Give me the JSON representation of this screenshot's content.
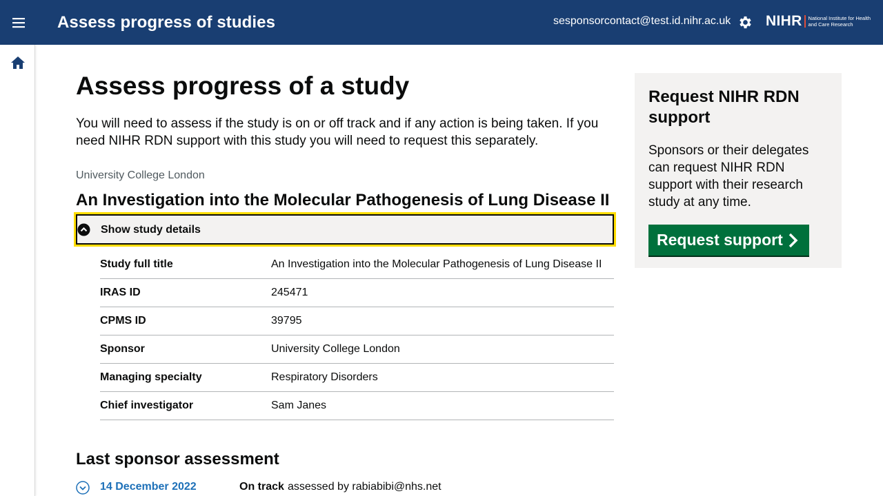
{
  "header": {
    "app_title": "Assess progress of studies",
    "user_email": "sesponsorcontact@test.id.nihr.ac.uk",
    "logo_main": "NIHR",
    "logo_sub": "National Institute for Health and Care Research",
    "brand_color": "#193e72"
  },
  "page": {
    "title": "Assess progress of a study",
    "lead": "You will need to assess if the study is on or off track and if any action is being taken. If you need NIHR RDN support with this study you will need to request this separately.",
    "organisation": "University College London",
    "study_title": "An Investigation into the Molecular Pathogenesis of Lung Disease II",
    "details_toggle_label": "Show study details"
  },
  "study_details": [
    {
      "key": "Study full title",
      "value": "An Investigation into the Molecular Pathogenesis of Lung Disease II"
    },
    {
      "key": "IRAS ID",
      "value": "245471"
    },
    {
      "key": "CPMS ID",
      "value": "39795"
    },
    {
      "key": "Sponsor",
      "value": "University College London"
    },
    {
      "key": "Managing specialty",
      "value": "Respiratory Disorders"
    },
    {
      "key": "Chief investigator",
      "value": "Sam Janes"
    }
  ],
  "last_assessment": {
    "heading": "Last sponsor assessment",
    "date": "14 December 2022",
    "status": "On track",
    "assessed_by": "assessed by rabiabibi@nhs.net"
  },
  "aside": {
    "heading": "Request NIHR RDN support",
    "body": "Sponsors or their delegates can request NIHR RDN support with their research study at any time.",
    "button_label": "Request support",
    "button_color": "#00703c"
  },
  "icons": [
    "menu-icon",
    "gear-icon",
    "home-icon",
    "chevron-up-circle-icon",
    "chevron-down-circle-icon",
    "chevron-right-icon"
  ]
}
